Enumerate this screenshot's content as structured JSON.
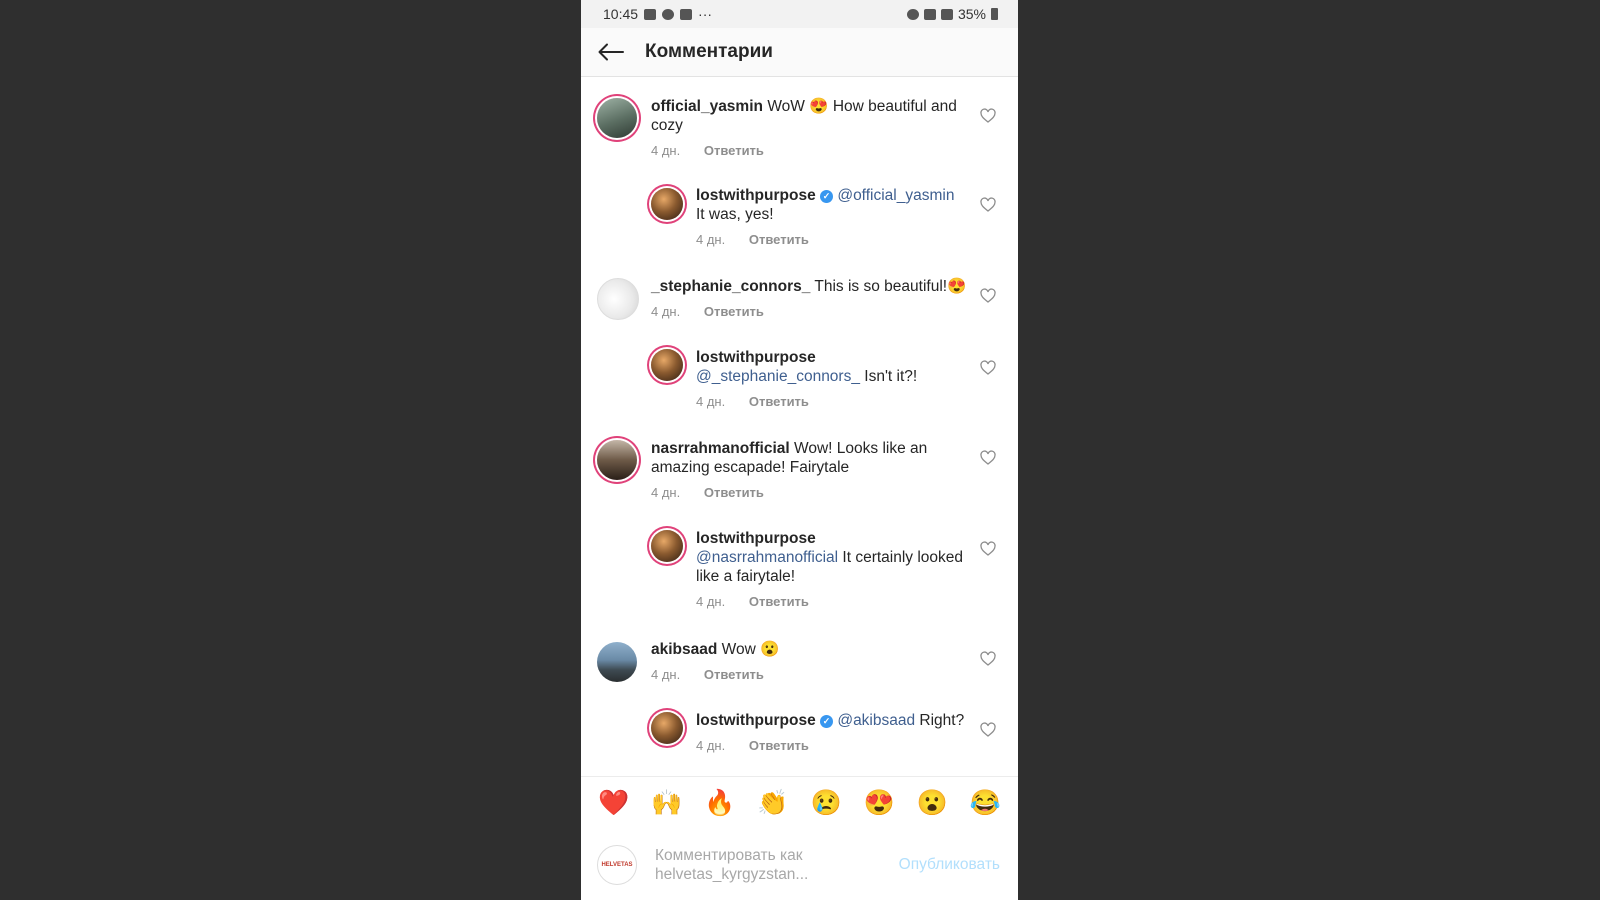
{
  "status_bar": {
    "time": "10:45",
    "dots": "···",
    "battery_percent": "35%"
  },
  "header": {
    "title": "Комментарии"
  },
  "comments": [
    {
      "user": "official_yasmin",
      "text": "WoW 😍 How beautiful and cozy",
      "age": "4 дн.",
      "reply_label": "Ответить"
    },
    {
      "user": "lostwithpurpose",
      "verified": true,
      "verified_mark": "✓",
      "mention": "@official_yasmin",
      "text": "It was, yes!",
      "age": "4 дн.",
      "reply_label": "Ответить"
    },
    {
      "user": "_stephanie_connors_",
      "text": "This is so beautiful!😍",
      "age": "4 дн.",
      "reply_label": "Ответить"
    },
    {
      "user": "lostwithpurpose",
      "mention": "@_stephanie_connors_",
      "text": "Isn't it?!",
      "age": "4 дн.",
      "reply_label": "Ответить"
    },
    {
      "user": "nasrrahmanofficial",
      "text": "Wow! Looks like an amazing escapade! Fairytale",
      "age": "4 дн.",
      "reply_label": "Ответить"
    },
    {
      "user": "lostwithpurpose",
      "mention": "@nasrrahmanofficial",
      "text": "It certainly looked like a fairytale!",
      "age": "4 дн.",
      "reply_label": "Ответить"
    },
    {
      "user": "akibsaad",
      "text": "Wow 😮",
      "age": "4 дн.",
      "reply_label": "Ответить"
    },
    {
      "user": "lostwithpurpose",
      "verified": true,
      "verified_mark": "✓",
      "mention": "@akibsaad",
      "text": "Right?",
      "age": "4 дн.",
      "reply_label": "Ответить"
    }
  ],
  "emoji_bar": [
    "❤️",
    "🙌",
    "🔥",
    "👏",
    "😢",
    "😍",
    "😮",
    "😂"
  ],
  "composer": {
    "avatar_text": "HELVETAS",
    "placeholder": "Комментировать как helvetas_kyrgyzstan...",
    "publish_label": "Опубликовать"
  },
  "colors": {
    "accent_link": "#3f5f8f",
    "publish_disabled": "#b2dffc",
    "verified": "#3897f0",
    "story_ring": "#e0427a"
  }
}
